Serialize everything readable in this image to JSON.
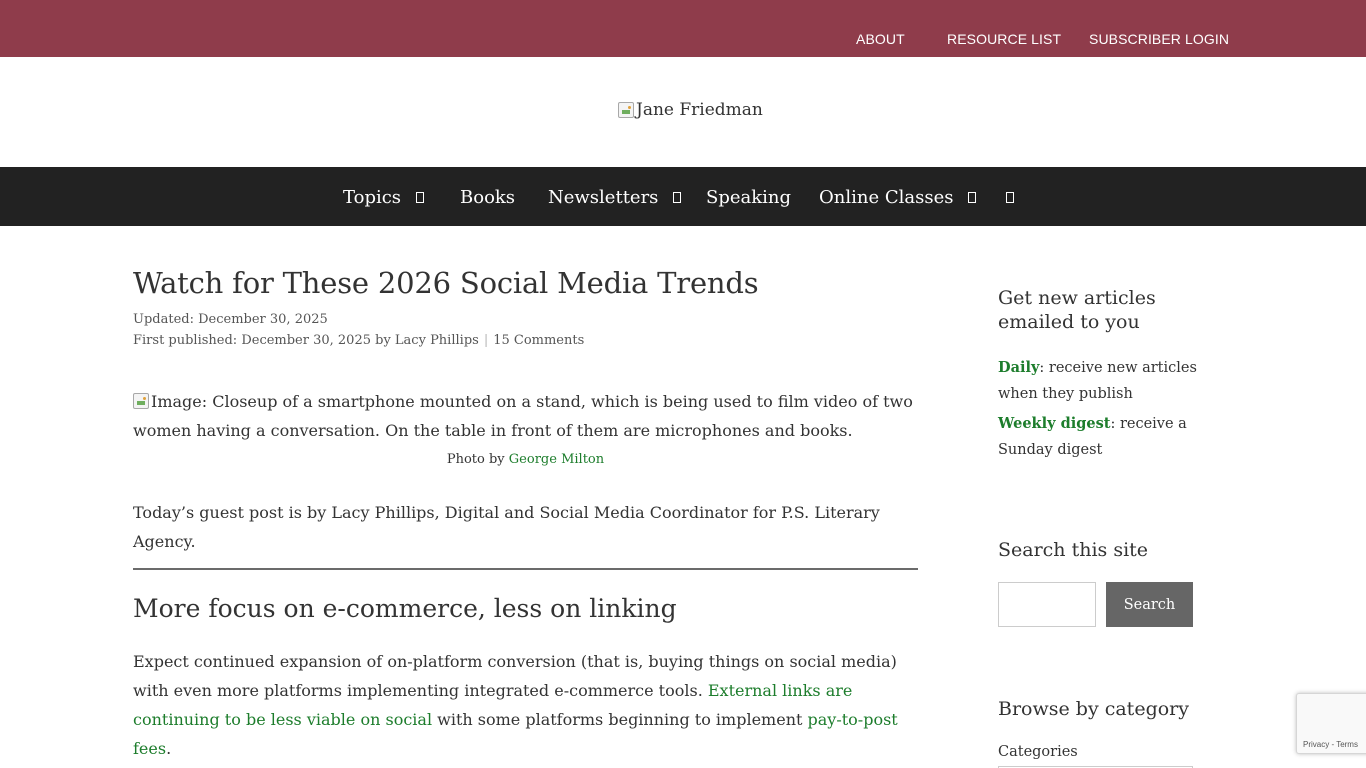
{
  "topbar": {
    "links": [
      "ABOUT",
      "RESOURCE LIST",
      "SUBSCRIBER LOGIN"
    ]
  },
  "brand": {
    "logo_alt": "Jane Friedman"
  },
  "nav": {
    "topics": "Topics",
    "books": "Books",
    "newsletters": "Newsletters",
    "speaking": "Speaking",
    "online_classes": "Online Classes"
  },
  "article": {
    "title": "Watch for These 2026 Social Media Trends",
    "updated": "Updated: December 30, 2025",
    "first_published": "First published: December 30, 2025 by Lacy Phillips",
    "comments": "15 Comments",
    "image_alt": "Image: Closeup of a smartphone mounted on a stand, which is being used to film video of two women having a conversation. On the table in front of them are microphones and books.",
    "photo_credit_prefix": "Photo by ",
    "photo_credit_name": "George Milton",
    "intro": "Today’s guest post is by Lacy Phillips, Digital and Social Media Coordinator for P.S. Literary Agency.",
    "section_heading": "More focus on e-commerce, less on linking",
    "body_1": "Expect continued expansion of on-platform conversion (that is, buying things on social media) with even more platforms implementing integrated e-commerce tools. ",
    "body_link_1": "External links are continuing to be less viable on social",
    "body_2": " with some platforms beginning to implement ",
    "body_link_2": "pay-to-post fees",
    "body_3": "."
  },
  "sidebar": {
    "newsletter_heading": "Get new articles emailed to you",
    "daily_label": "Daily",
    "daily_text": ": receive new articles when they publish",
    "weekly_label": "Weekly digest",
    "weekly_text": ": receive a Sunday digest",
    "search_heading": "Search this site",
    "search_placeholder": "",
    "search_button": "Search",
    "browse_heading": "Browse by category",
    "categories_label": "Categories"
  },
  "recaptcha": {
    "terms": "Privacy - Terms"
  },
  "colors": {
    "topbar": "#8f3c4b",
    "nav": "#222222",
    "link": "#1d7d2c",
    "search_button": "#666666"
  }
}
